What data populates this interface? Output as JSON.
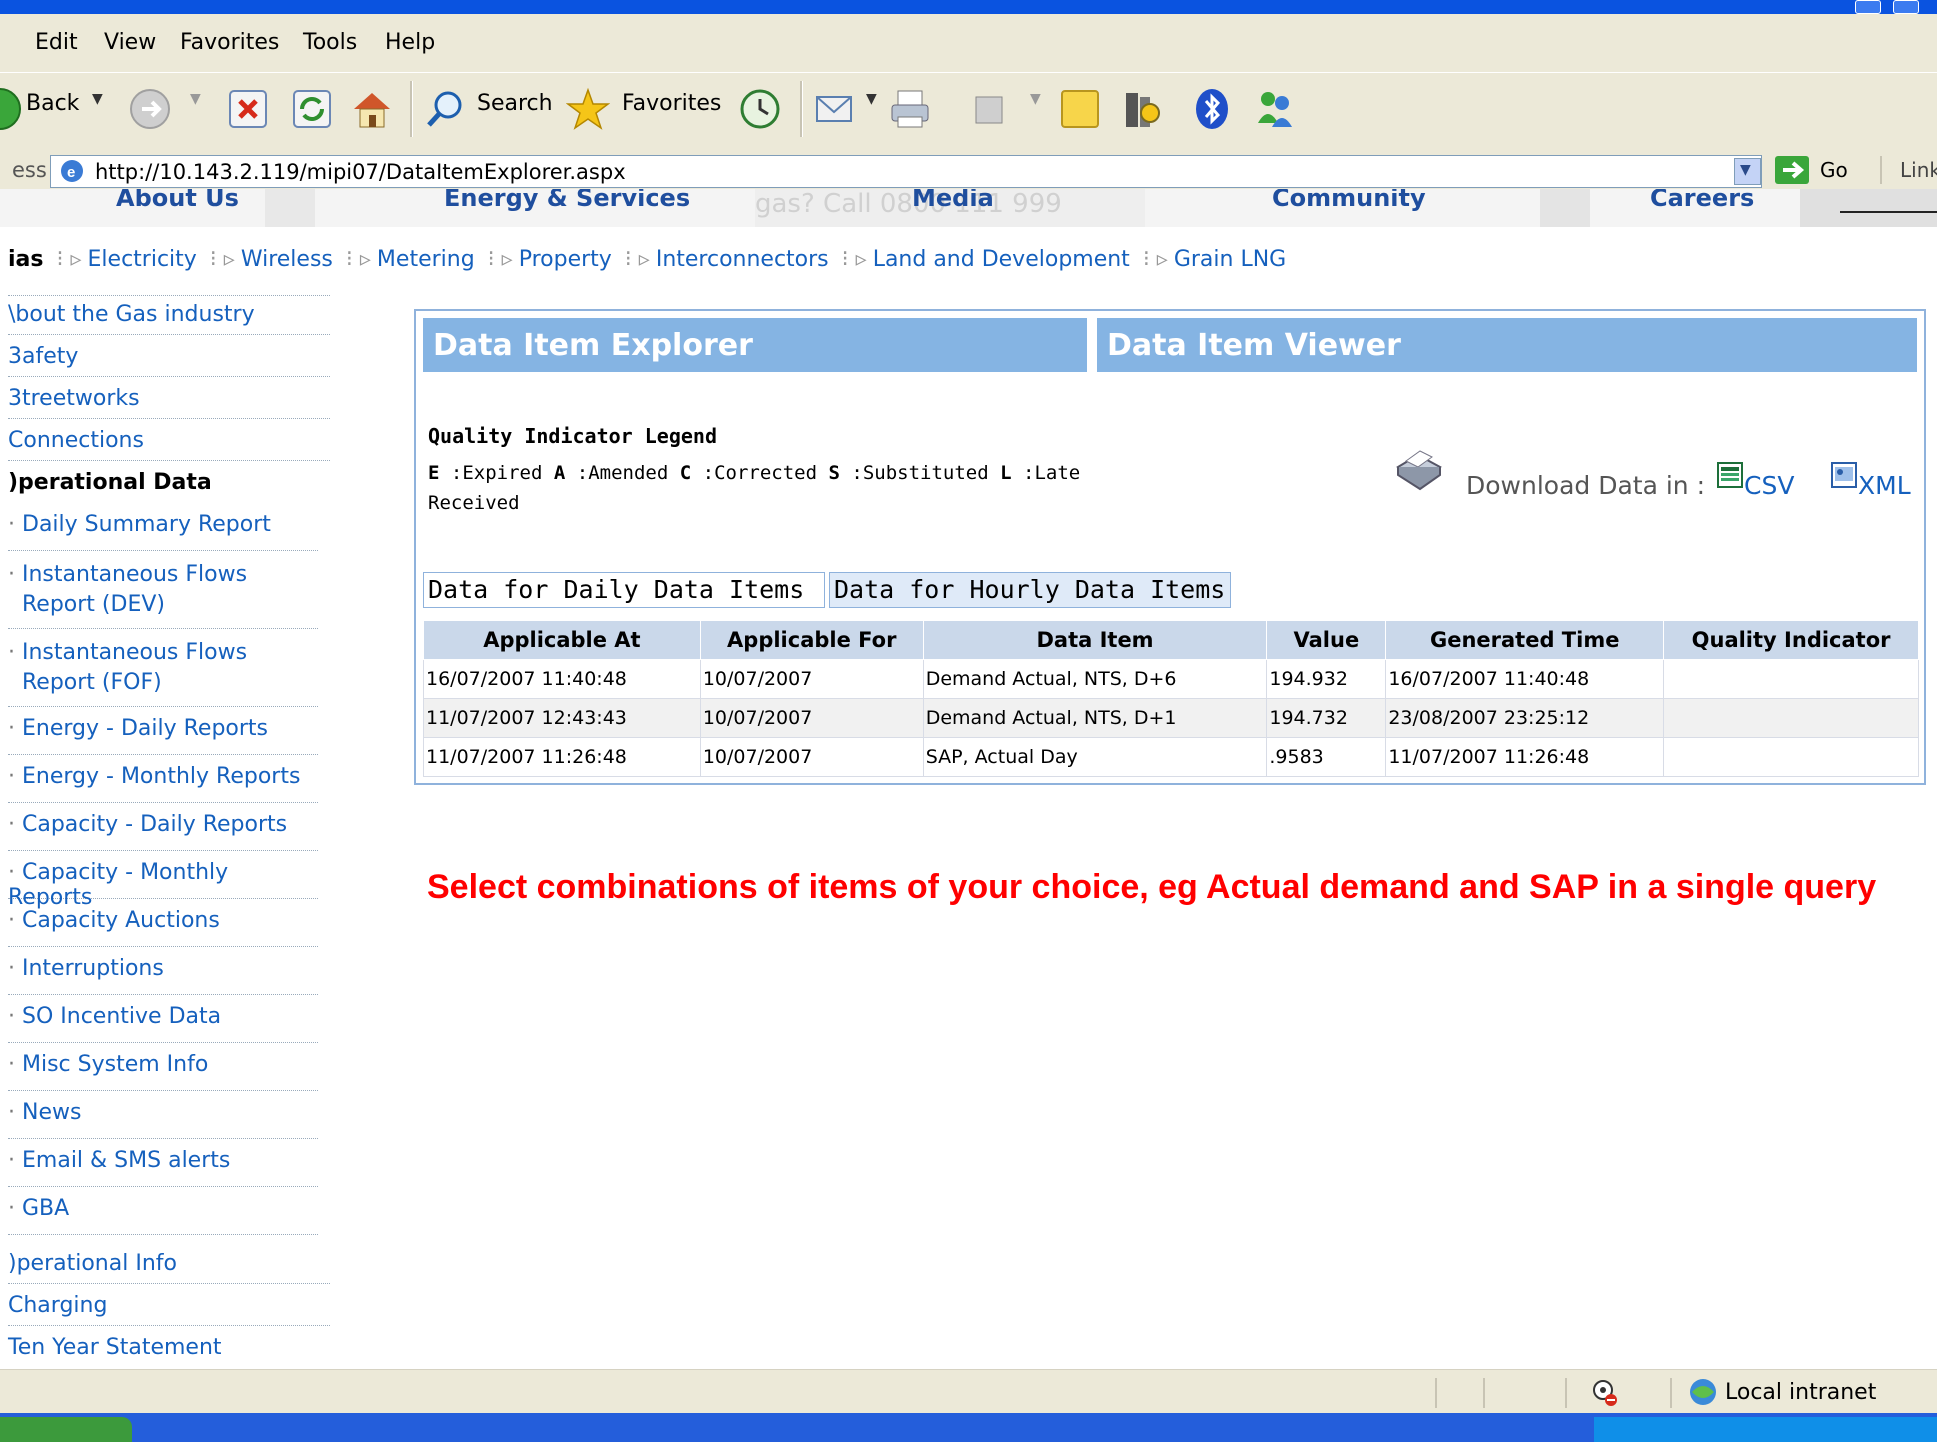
{
  "menubar": {
    "items": [
      "Edit",
      "View",
      "Favorites",
      "Tools",
      "Help"
    ]
  },
  "toolbar": {
    "back_label": "Back",
    "search_label": "Search",
    "favorites_label": "Favorites"
  },
  "address": {
    "label": "ess",
    "url": "http://10.143.2.119/mipi07/DataItemExplorer.aspx",
    "go_label": "Go",
    "links_label": "Link"
  },
  "site_nav": {
    "items": [
      "About Us",
      "Energy & Services",
      "Media",
      "Community",
      "Careers"
    ],
    "banner_fragment": "gas? Call 0800 111 999"
  },
  "sub_nav": {
    "current": "ias",
    "links": [
      "Electricity",
      "Wireless",
      "Metering",
      "Property",
      "Interconnectors",
      "Land and Development",
      "Grain LNG"
    ]
  },
  "sidebar": {
    "top_items": [
      "\\bout the Gas industry",
      "3afety",
      "3treetworks",
      "Connections"
    ],
    "section_title": ")perational Data",
    "sub_items": [
      "Daily Summary Report",
      "Instantaneous Flows Report (DEV)",
      "Instantaneous Flows Report (FOF)",
      "Energy - Daily Reports",
      "Energy - Monthly Reports",
      "Capacity - Daily Reports",
      "Capacity - Monthly Reports",
      "Capacity Auctions",
      "Interruptions",
      "SO Incentive Data",
      "Misc System Info",
      "News",
      "Email & SMS alerts",
      "GBA"
    ],
    "bottom_items": [
      ")perational Info",
      "Charging",
      "Ten Year Statement"
    ]
  },
  "panel": {
    "explorer_title": "Data Item Explorer",
    "viewer_title": "Data Item Viewer",
    "legend_title": "Quality Indicator Legend",
    "legend": [
      {
        "code": "E",
        "label": ":Expired"
      },
      {
        "code": "A",
        "label": ":Amended"
      },
      {
        "code": "C",
        "label": ":Corrected"
      },
      {
        "code": "S",
        "label": ":Substituted"
      },
      {
        "code": "L",
        "label": ":Late Received"
      }
    ],
    "download_label": "Download Data in :",
    "csv_label": "CSV",
    "xml_label": "XML",
    "tab_daily": "Data for Daily Data Items",
    "tab_hourly": "Data for Hourly Data Items",
    "columns": [
      "Applicable At",
      "Applicable For",
      "Data Item",
      "Value",
      "Generated Time",
      "Quality Indicator"
    ],
    "rows": [
      [
        "16/07/2007 11:40:48",
        "10/07/2007",
        "Demand Actual, NTS, D+6",
        "194.932",
        "16/07/2007 11:40:48",
        ""
      ],
      [
        "11/07/2007 12:43:43",
        "10/07/2007",
        "Demand Actual, NTS, D+1",
        "194.732",
        "23/08/2007 23:25:12",
        ""
      ],
      [
        "11/07/2007 11:26:48",
        "10/07/2007",
        "SAP, Actual Day",
        ".9583",
        "11/07/2007 11:26:48",
        ""
      ]
    ]
  },
  "annotation": "Select combinations of items of your choice, eg Actual demand and SAP in a single query",
  "statusbar": {
    "zone": "Local intranet"
  },
  "colors": {
    "xp_blue": "#0a53e0",
    "chrome": "#ece9d8",
    "header_blue": "#85b4e3",
    "annotation_red": "#ff0000",
    "link_blue": "#1560bd"
  }
}
